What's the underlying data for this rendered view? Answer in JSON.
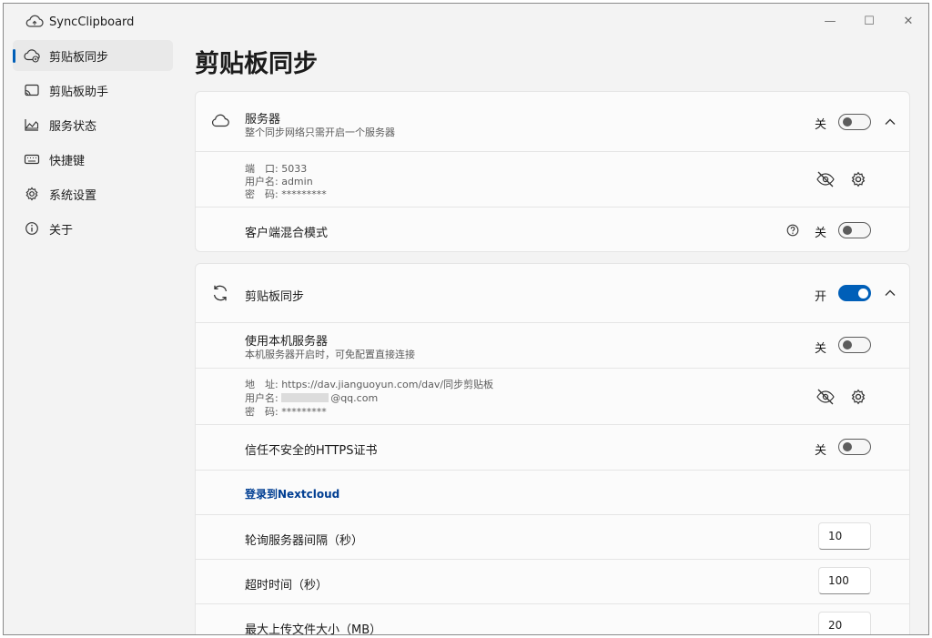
{
  "window": {
    "app_title": "SyncClipboard",
    "controls": {
      "minimize": "—",
      "maximize": "☐",
      "close": "✕"
    }
  },
  "sidebar": {
    "items": [
      {
        "label": "剪贴板同步",
        "icon": "cloud-sync-icon",
        "active": true
      },
      {
        "label": "剪贴板助手",
        "icon": "cast-icon"
      },
      {
        "label": "服务状态",
        "icon": "area-chart-icon"
      },
      {
        "label": "快捷键",
        "icon": "keyboard-icon"
      },
      {
        "label": "系统设置",
        "icon": "gear-icon"
      },
      {
        "label": "关于",
        "icon": "info-icon"
      }
    ]
  },
  "page": {
    "title": "剪贴板同步"
  },
  "server_card": {
    "title": "服务器",
    "subtitle": "整个同步网络只需开启一个服务器",
    "toggle_label": "关",
    "info": {
      "port": "端　口: 5033",
      "username": "用户名: admin",
      "password": "密　码: *********"
    },
    "mixed_mode": {
      "title": "客户端混合模式",
      "toggle_label": "关"
    }
  },
  "sync_card": {
    "title": "剪贴板同步",
    "toggle_label": "开",
    "use_local": {
      "title": "使用本机服务器",
      "subtitle": "本机服务器开启时，可免配置直接连接",
      "toggle_label": "关"
    },
    "info": {
      "address": "地　址: https://dav.jianguoyun.com/dav/同步剪贴板",
      "username_prefix": "用户名: ",
      "username_suffix": "@qq.com",
      "password": "密　码: *********"
    },
    "trust_https": {
      "title": "信任不安全的HTTPS证书",
      "toggle_label": "关"
    },
    "nextcloud_link": "登录到Nextcloud",
    "poll_interval": {
      "title": "轮询服务器间隔（秒）",
      "value": "10"
    },
    "timeout": {
      "title": "超时时间（秒）",
      "value": "100"
    },
    "max_upload": {
      "title": "最大上传文件大小（MB）",
      "value": "20"
    }
  },
  "colors": {
    "accent": "#005fb8",
    "link": "#003e92",
    "background": "#f3f3f3",
    "card": "#fbfbfb"
  }
}
